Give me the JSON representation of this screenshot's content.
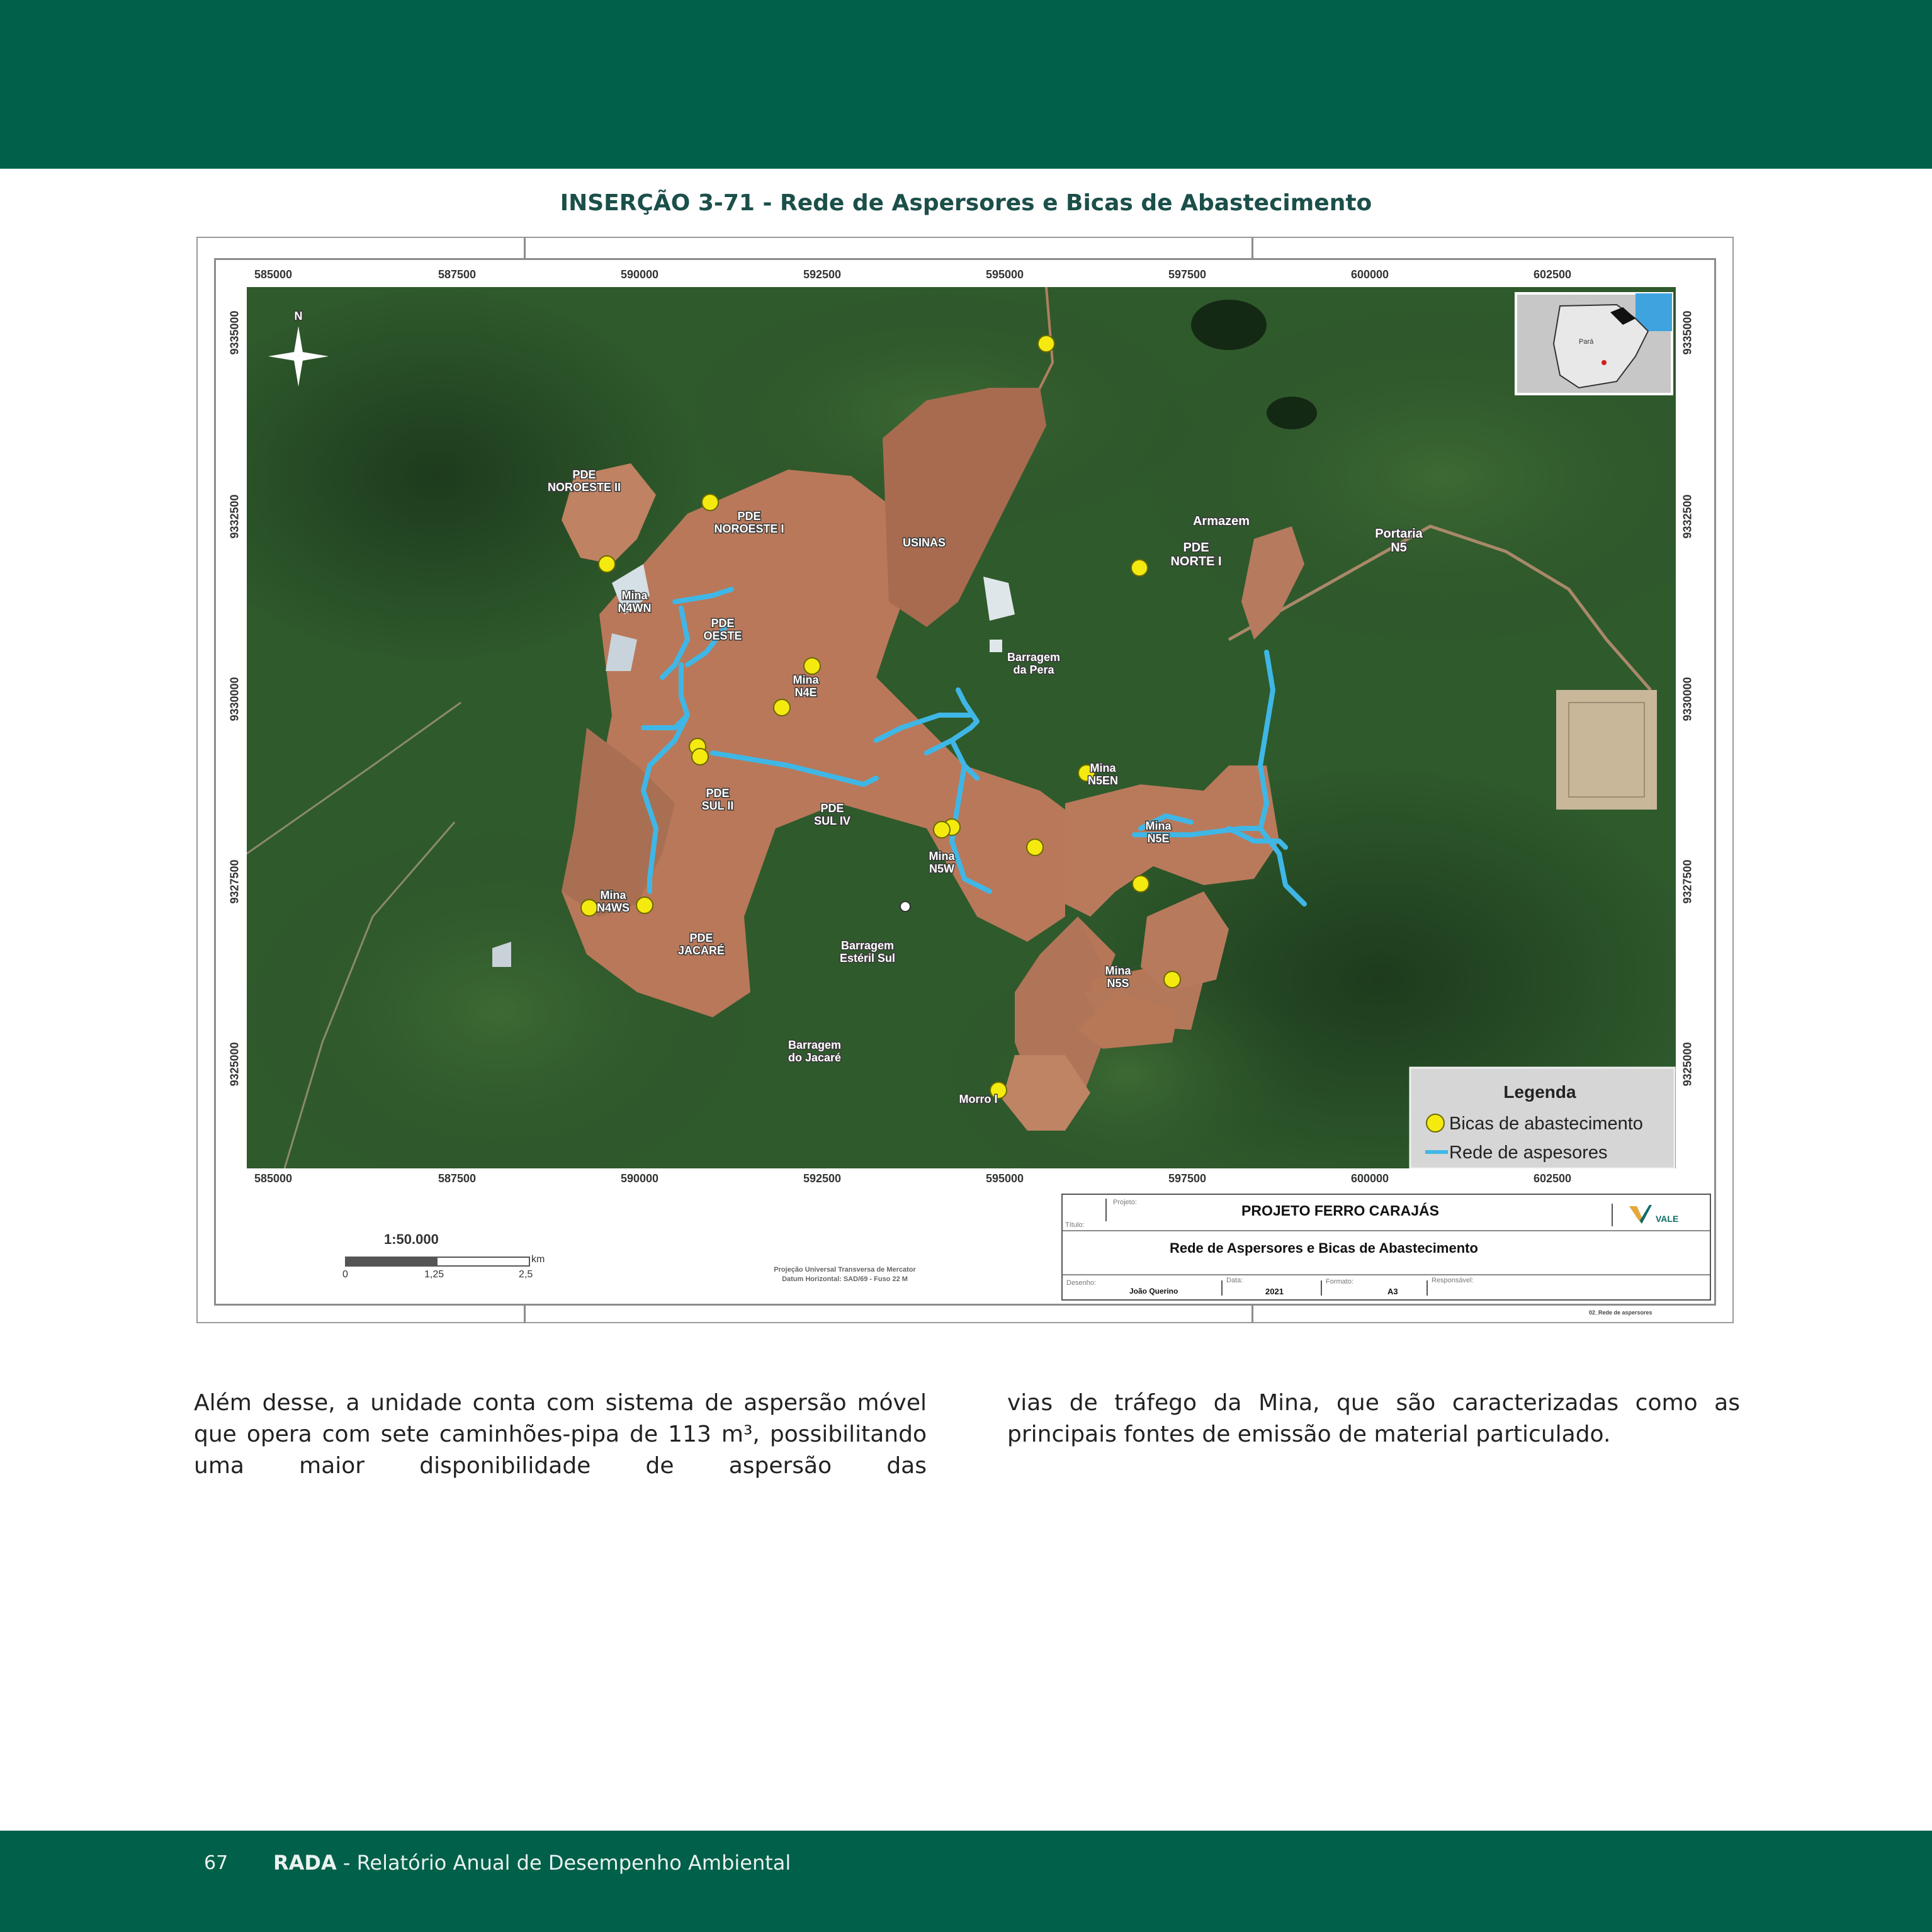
{
  "figure": {
    "caption": "INSERÇÃO 3-71 - Rede de Aspersores e Bicas de Abastecimento",
    "coords_x": [
      "585000",
      "587500",
      "590000",
      "592500",
      "595000",
      "597500",
      "600000",
      "602500"
    ],
    "coords_y": [
      "9335000",
      "9332500",
      "9330000",
      "9327500",
      "9325000"
    ],
    "north": "N",
    "labels": {
      "pde_noroeste_ii": [
        "PDE",
        "NOROESTE II"
      ],
      "pde_noroeste_i": [
        "PDE",
        "NOROESTE I"
      ],
      "usinas": [
        "USINAS"
      ],
      "armazem": [
        "Armazem"
      ],
      "portaria": [
        "Portaria",
        "N5"
      ],
      "pde_norte_i": [
        "PDE",
        "NORTE I"
      ],
      "mina_n4wn": [
        "Mina",
        "N4WN"
      ],
      "pde_oeste": [
        "PDE",
        "OESTE"
      ],
      "mina_n4e": [
        "Mina",
        "N4E"
      ],
      "barragem_pera": [
        "Barragem",
        "da Pera"
      ],
      "mina_n5en": [
        "Mina",
        "N5EN"
      ],
      "mina_n5e": [
        "Mina",
        "N5E"
      ],
      "pde_sul_ii": [
        "PDE",
        "SUL II"
      ],
      "pde_sul_iv": [
        "PDE",
        "SUL IV"
      ],
      "mina_n5w": [
        "Mina",
        "N5W"
      ],
      "mina_n4ws": [
        "Mina",
        "N4WS"
      ],
      "pde_jacare": [
        "PDE",
        "JACARÉ"
      ],
      "barragem_esteril": [
        "Barragem",
        "Estéril Sul"
      ],
      "mina_n5s": [
        "Mina",
        "N5S"
      ],
      "barragem_jacare": [
        "Barragem",
        "do Jacaré"
      ],
      "morro_i": [
        "Morro I"
      ]
    },
    "inset": {
      "label": "Pará"
    },
    "legend": {
      "title": "Legenda",
      "item1": "Bicas de abastecimento",
      "item2": "Rede de aspesores",
      "color_bicas": "#f5ea10",
      "color_rede": "#3fb7e6"
    },
    "scale": {
      "ratio": "1:50.000",
      "t0": "0",
      "t1": "1,25",
      "t2": "2,5",
      "unit": "km"
    },
    "projection": [
      "Projeção Universal Transversa de Mercator",
      "Datum Horizontal: SAD/69 - Fuso 22 M"
    ],
    "title_block": {
      "projeto_lbl": "Projeto:",
      "projeto": "PROJETO FERRO CARAJÁS",
      "titulo_lbl": "Título:",
      "titulo": "Rede de Aspersores e Bicas de Abastecimento",
      "desenho_lbl": "Desenho:",
      "desenho": "João Querino",
      "data_lbl": "Data:",
      "data": "2021",
      "formato_lbl": "Formato:",
      "formato": "A3",
      "responsavel_lbl": "Responsável:",
      "logo": "VALE",
      "file": "02_Rede de aspersores"
    }
  },
  "body": {
    "col1": "Além desse, a unidade conta com sistema de aspersão móvel que opera com sete caminhões-pipa de 113 m³, possibilitando uma maior disponibilidade de aspersão das",
    "col2": "vias de tráfego da Mina, que são caracterizadas como as principais fontes de emissão de material particulado."
  },
  "footer": {
    "page": "67",
    "brand": "RADA",
    "title": " - Relatório Anual de Desempenho Ambiental"
  },
  "colors": {
    "header_green": "#00604a",
    "caption": "#1b4f4a"
  }
}
